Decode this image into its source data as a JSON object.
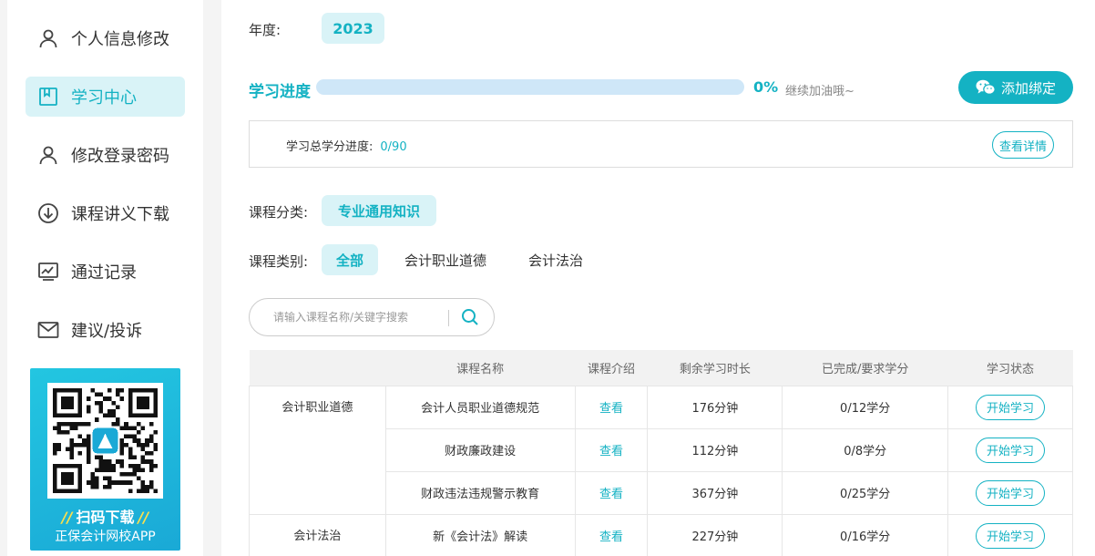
{
  "sidebar": {
    "items": [
      {
        "label": "个人信息修改",
        "icon": "user-icon"
      },
      {
        "label": "学习中心",
        "icon": "book-icon",
        "active": true
      },
      {
        "label": "修改登录密码",
        "icon": "user-icon"
      },
      {
        "label": "课程讲义下载",
        "icon": "download-icon"
      },
      {
        "label": "通过记录",
        "icon": "chart-icon"
      },
      {
        "label": "建议/投诉",
        "icon": "mail-icon"
      }
    ],
    "qr": {
      "title": "扫码下载",
      "subtitle": "正保会计网校APP"
    }
  },
  "main": {
    "year_label": "年度:",
    "year_value": "2023",
    "progress": {
      "label": "学习进度",
      "percent_text": "0%",
      "fraction": 0,
      "hint": "继续加油哦~"
    },
    "bind_button": "添加绑定",
    "credit": {
      "label": "学习总学分进度:",
      "value": "0/90",
      "detail_button": "查看详情"
    },
    "category": {
      "label": "课程分类:",
      "selected": "专业通用知识"
    },
    "type": {
      "label": "课程类别:",
      "options": [
        "全部",
        "会计职业道德",
        "会计法治"
      ],
      "selected": "全部"
    },
    "search": {
      "placeholder": "请输入课程名称/关键字搜索"
    },
    "table": {
      "headers": [
        "",
        "课程名称",
        "课程介绍",
        "剩余学习时长",
        "已完成/要求学分",
        "学习状态"
      ],
      "rows": [
        {
          "category": "会计职业道德",
          "name": "会计人员职业道德规范",
          "intro": "查看",
          "remaining": "176分钟",
          "credits": "0/12学分",
          "status": "开始学习"
        },
        {
          "category": "",
          "name": "财政廉政建设",
          "intro": "查看",
          "remaining": "112分钟",
          "credits": "0/8学分",
          "status": "开始学习"
        },
        {
          "category": "",
          "name": "财政违法违规警示教育",
          "intro": "查看",
          "remaining": "367分钟",
          "credits": "0/25学分",
          "status": "开始学习"
        },
        {
          "category": "会计法治",
          "name": "新《会计法》解读",
          "intro": "查看",
          "remaining": "227分钟",
          "credits": "0/16学分",
          "status": "开始学习"
        }
      ]
    }
  },
  "colors": {
    "accent": "#14b2c3",
    "accent_light": "#d9f3f7",
    "progress_track": "#cfe7f8"
  }
}
